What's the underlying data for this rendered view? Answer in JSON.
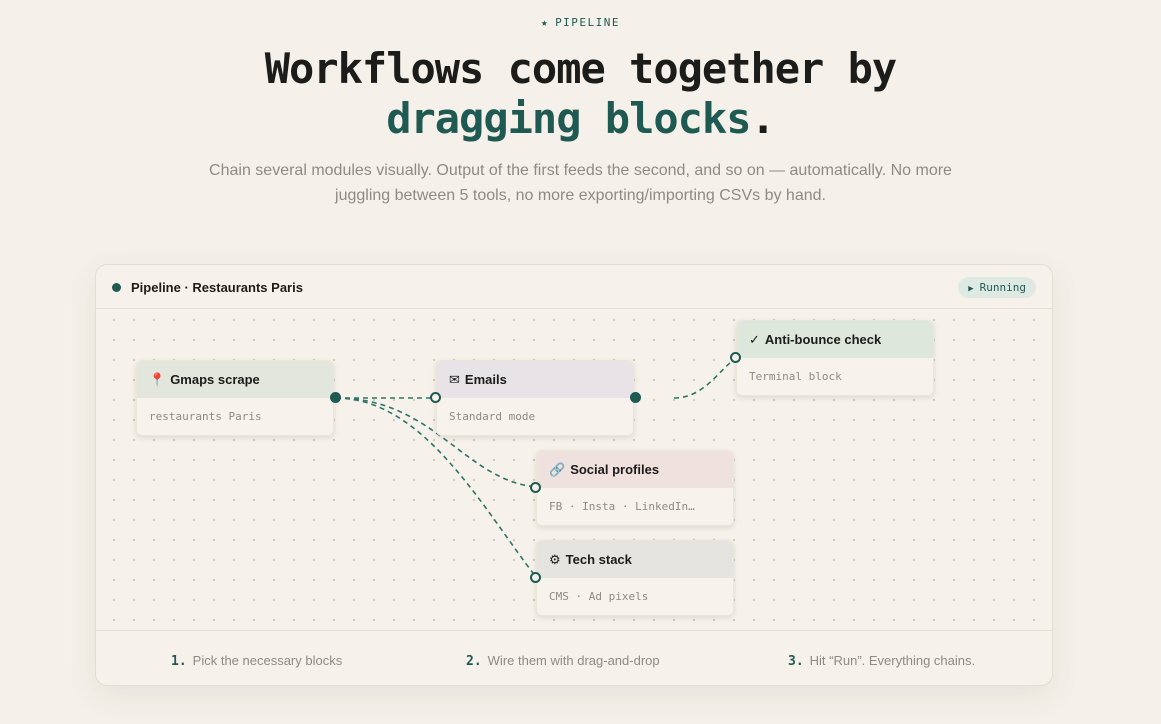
{
  "eyebrow": {
    "icon": "star-icon",
    "text": "PIPELINE"
  },
  "headline": {
    "line1": "Workflows come together by",
    "accent": "dragging blocks",
    "period": "."
  },
  "subtitle": {
    "line1": "Chain several modules visually. Output of the first feeds the second, and so on — automatically. No more",
    "line2": "juggling between 5 tools, no more exporting/importing CSVs by hand."
  },
  "panel": {
    "title": "Pipeline · Restaurants Paris",
    "status": "Running"
  },
  "nodes": {
    "gmaps": {
      "icon": "📍",
      "title": "Gmaps scrape",
      "body": "restaurants Paris"
    },
    "emails": {
      "icon": "✉",
      "title": "Emails",
      "body": "Standard mode"
    },
    "antibounce": {
      "icon": "✓",
      "title": "Anti-bounce check",
      "body": "Terminal block"
    },
    "social": {
      "icon": "🔗",
      "title": "Social profiles",
      "body": "FB · Insta · LinkedIn…"
    },
    "tech": {
      "icon": "⚙",
      "title": "Tech stack",
      "body": "CMS · Ad pixels"
    }
  },
  "steps": [
    {
      "num": "1.",
      "label": "Pick the necessary blocks"
    },
    {
      "num": "2.",
      "label": "Wire them with drag-and-drop"
    },
    {
      "num": "3.",
      "label": "Hit “Run”. Everything chains."
    }
  ],
  "colors": {
    "accent": "#1e5a52",
    "background": "#f5f1ea"
  }
}
